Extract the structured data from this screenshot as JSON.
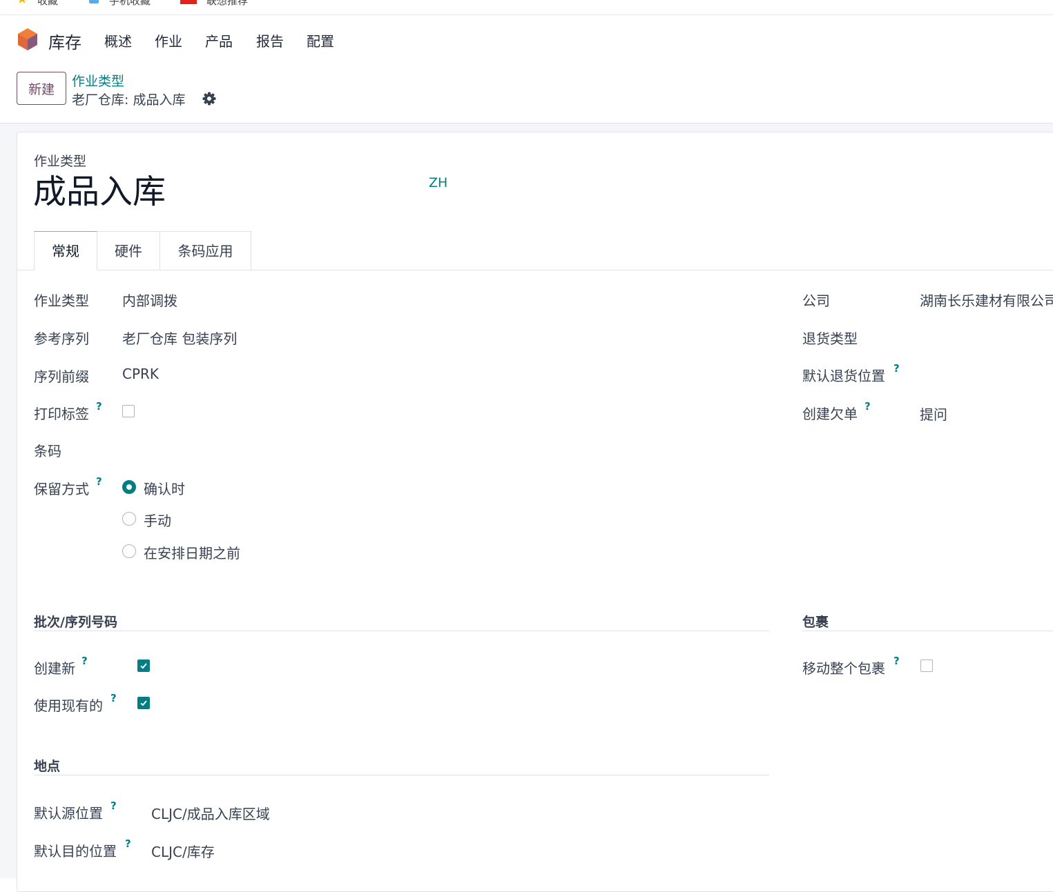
{
  "bookmarks": [
    "收藏",
    "手机收藏",
    "联想推荐"
  ],
  "nav": {
    "app_name": "库存",
    "menu": [
      "概述",
      "作业",
      "产品",
      "报告",
      "配置"
    ]
  },
  "control": {
    "new_label": "新建",
    "breadcrumb_parent": "作业类型",
    "breadcrumb_current": "老厂仓库: 成品入库"
  },
  "form": {
    "title_label": "作业类型",
    "title": "成品入库",
    "lang": "ZH",
    "tabs": [
      "常规",
      "硬件",
      "条码应用"
    ],
    "left": {
      "operation_type_label": "作业类型",
      "operation_type_value": "内部调拨",
      "sequence_label": "参考序列",
      "sequence_value": "老厂仓库 包装序列",
      "prefix_label": "序列前缀",
      "prefix_value": "CPRK",
      "print_label_label": "打印标签",
      "barcode_label": "条码",
      "reservation_label": "保留方式",
      "reservation_options": [
        "确认时",
        "手动",
        "在安排日期之前"
      ]
    },
    "right": {
      "company_label": "公司",
      "company_value": "湖南长乐建材有限公司",
      "return_type_label": "退货类型",
      "default_return_loc_label": "默认退货位置",
      "backorder_label": "创建欠单",
      "backorder_value": "提问"
    },
    "lots": {
      "title": "批次/序列号码",
      "create_new_label": "创建新",
      "use_existing_label": "使用现有的"
    },
    "packages": {
      "title": "包裹",
      "move_entire_label": "移动整个包裹"
    },
    "locations": {
      "title": "地点",
      "src_label": "默认源位置",
      "src_value": "CLJC/成品入库区域",
      "dest_label": "默认目的位置",
      "dest_value": "CLJC/库存"
    },
    "help_mark": "?"
  },
  "colors": {
    "accent": "#017e84",
    "brand": "#714b67"
  }
}
